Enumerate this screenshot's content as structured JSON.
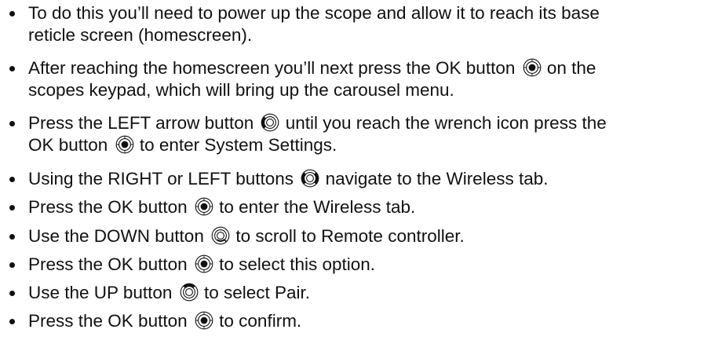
{
  "instructions": {
    "icons": {
      "ok": "keypad-ok-button-icon",
      "left": "keypad-left-button-icon",
      "left_right": "keypad-left-right-buttons-icon",
      "down": "keypad-down-button-icon",
      "up": "keypad-up-button-icon"
    },
    "steps": [
      {
        "line1": "To do this you’ll need to power up the scope and allow it to reach its base",
        "line2": "reticle screen (homescreen)."
      },
      {
        "line1_before": "After reaching the homescreen you’ll next press the OK button",
        "line1_after": "on the",
        "line2": "scopes keypad, which will bring up the carousel menu."
      },
      {
        "line1_before": "Press the LEFT arrow button",
        "line1_after": "until you reach the wrench icon press the",
        "line2_before": "OK button",
        "line2_after": "to enter System Settings."
      },
      {
        "before": "Using the RIGHT or LEFT buttons",
        "after": "navigate to the Wireless tab."
      },
      {
        "before": "Press the OK button",
        "after": "to enter the Wireless tab."
      },
      {
        "before": "Use the DOWN button",
        "after": "to scroll to Remote controller."
      },
      {
        "before": "Press the OK button",
        "after": "to select this option."
      },
      {
        "before": "Use the UP button",
        "after": "to select Pair."
      },
      {
        "before": "Press the OK button",
        "after": "to confirm."
      }
    ]
  }
}
